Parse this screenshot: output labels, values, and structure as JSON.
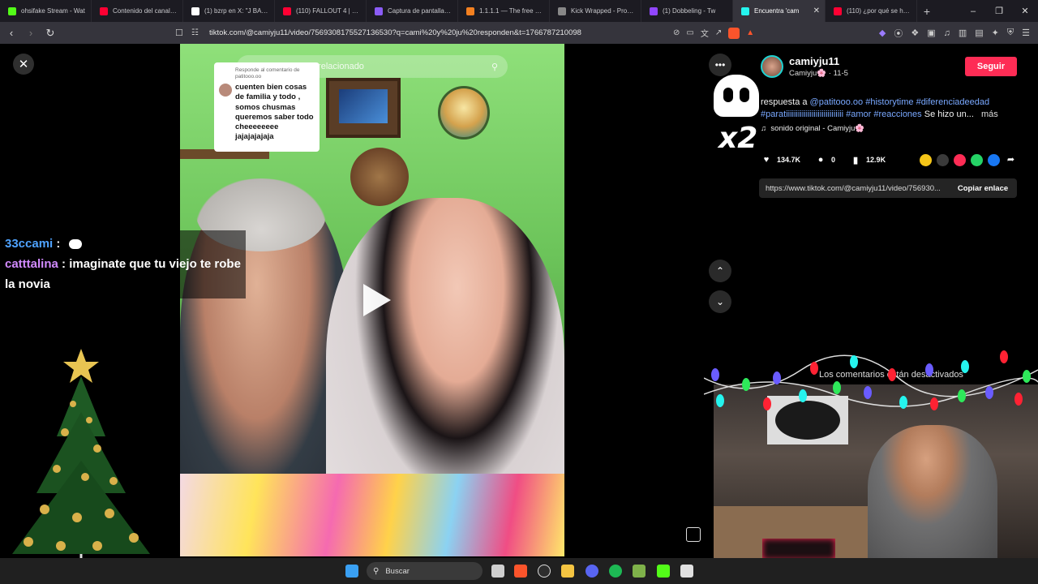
{
  "browser": {
    "tabs": [
      {
        "title": "ohsifake Stream - Wat",
        "favicon_color": "#53fc18"
      },
      {
        "title": "Contenido del canal - Y",
        "favicon_color": "#ff0033"
      },
      {
        "title": "(1) bzrp en X: \"J BALVI",
        "favicon_color": "#ffffff"
      },
      {
        "title": "(110) FALLOUT 4 | PRIM",
        "favicon_color": "#ff0033"
      },
      {
        "title": "Captura de pantalla po",
        "favicon_color": "#8b5cf6"
      },
      {
        "title": "1.1.1.1 — The free app",
        "favicon_color": "#f38020"
      },
      {
        "title": "Kick Wrapped - Proces",
        "favicon_color": "#888888"
      },
      {
        "title": "(1) Dobbeling - Tw",
        "favicon_color": "#9146ff"
      },
      {
        "title": "Encuentra 'cam",
        "favicon_color": "#25f4ee",
        "active": true
      },
      {
        "title": "(110) ¿por qué se hace",
        "favicon_color": "#ff0033"
      }
    ],
    "new_tab": "+",
    "url": "tiktok.com/@camiyju11/video/7569308175527136530?q=cami%20y%20ju%20responden&t=1766787210098"
  },
  "video": {
    "search_placeholder": "Buscar contenido relacionado",
    "reply_to": "Responde al comentario de patitooo.oo",
    "reply_text": "cuenten bien cosas de familia y todo , somos chusmas queremos saber todo cheeeeeeee jajajajajaja"
  },
  "post": {
    "username": "camiyju11",
    "display_name": "Camiyju🌸",
    "date": "11-5",
    "follow_label": "Seguir",
    "caption_prefix": "respuesta a",
    "mention": "@patitooo.oo",
    "hashtags_line1": "#historytime #diferenciadeedad",
    "hashtags_line2": "#paratiiiiiiiiiiiiiiiiiiiiiiiiiiiii #amor #reacciones",
    "caption_tail": "Se hizo un...",
    "more_label": "más",
    "sound": "sonido original - Camiyju🌸",
    "likes": "134.7K",
    "comments": "0",
    "saves": "12.9K",
    "link": "https://www.tiktok.com/@camiyju11/video/756930...",
    "copy_label": "Copiar enlace",
    "comments_disabled": "Los comentarios están desactivados"
  },
  "overlay": {
    "chat": [
      {
        "user": "33ccami",
        "text": ""
      },
      {
        "user": "catttalina",
        "text": "imaginate que tu viejo te robe la novia"
      }
    ],
    "multiplier": "x2"
  },
  "taskbar": {
    "search_label": "Buscar"
  },
  "colors": {
    "accent_follow": "#fe2c55",
    "hashtag": "#79a8ff",
    "chat_user1": "#4fa3ff",
    "chat_user2": "#d28bff"
  }
}
